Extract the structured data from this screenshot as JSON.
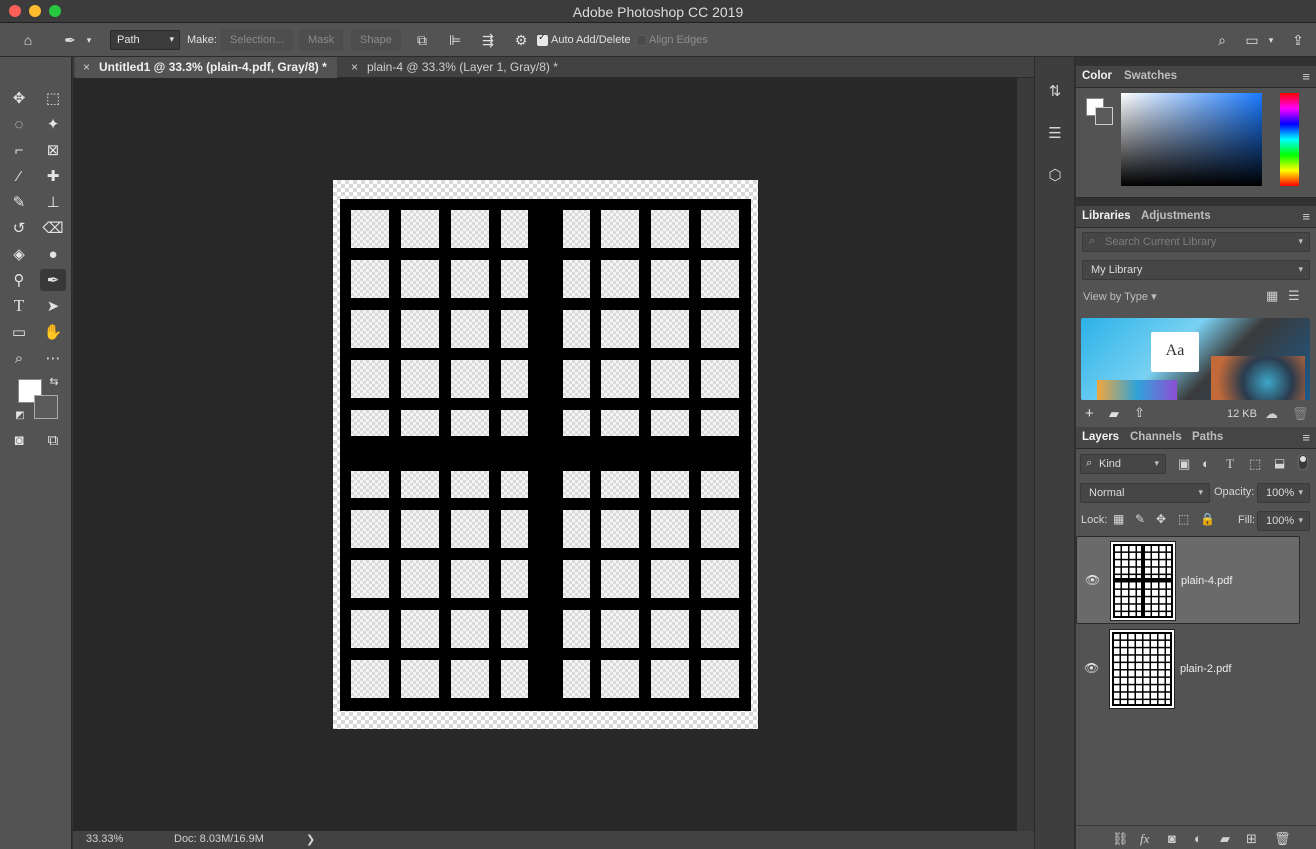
{
  "window": {
    "title": "Adobe Photoshop CC 2019"
  },
  "options_bar": {
    "mode": "Path",
    "make_label": "Make:",
    "selection_label": "Selection...",
    "mask_label": "Mask",
    "shape_label": "Shape",
    "auto_add_delete_label": "Auto Add/Delete",
    "auto_add_delete_checked": true,
    "align_edges_label": "Align Edges",
    "align_edges_checked": false
  },
  "tabs": [
    {
      "label": "Untitled1 @ 33.3% (plain-4.pdf, Gray/8) *",
      "active": true
    },
    {
      "label": "plain-4 @ 33.3% (Layer 1, Gray/8) *",
      "active": false
    }
  ],
  "status": {
    "zoom": "33.33%",
    "doc": "Doc: 8.03M/16.9M",
    "arrow": "❯"
  },
  "color_panel": {
    "tabs": [
      "Color",
      "Swatches"
    ]
  },
  "libraries_panel": {
    "tabs": [
      "Libraries",
      "Adjustments"
    ],
    "search_placeholder": "Search Current Library",
    "library": "My Library",
    "view_by": "View by Type",
    "size": "12 KB",
    "promo_text": "Aa"
  },
  "layers_panel": {
    "tabs": [
      "Layers",
      "Channels",
      "Paths"
    ],
    "kind": "Kind",
    "blend_mode": "Normal",
    "opacity_label": "Opacity:",
    "opacity": "100%",
    "lock_label": "Lock:",
    "fill_label": "Fill:",
    "fill": "100%",
    "layers": [
      {
        "name": "plain-4.pdf",
        "selected": true
      },
      {
        "name": "plain-2.pdf",
        "selected": false
      }
    ]
  },
  "colors": {
    "accent": "#535353",
    "canvas_bg": "#282828",
    "foreground": "#ffffff",
    "background": "#5a5a5a"
  }
}
